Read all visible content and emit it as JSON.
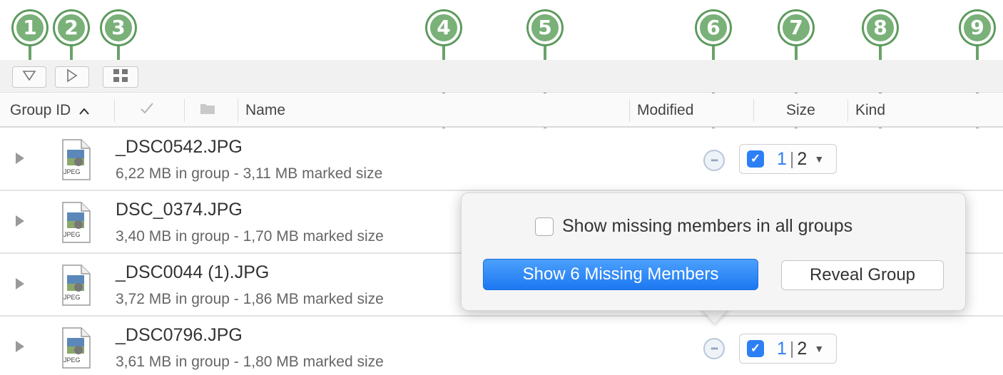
{
  "callouts": [
    "1",
    "2",
    "3",
    "4",
    "5",
    "6",
    "7",
    "8",
    "9"
  ],
  "toolbar": {
    "buttons": [
      {
        "icon": "triangle-down-outline-icon"
      },
      {
        "icon": "triangle-right-outline-icon"
      },
      {
        "icon": "grid-squares-icon"
      }
    ]
  },
  "header": {
    "group_id": "Group ID",
    "sort_indicator": "^",
    "check_icon": "checkmark-icon",
    "folder_icon": "folder-icon",
    "name": "Name",
    "modified": "Modified",
    "size": "Size",
    "kind": "Kind"
  },
  "rows": [
    {
      "name": "_DSC0542.JPG",
      "sub": "6,22 MB in group - 3,11 MB marked size",
      "icon_label": "JPEG",
      "marked": "1",
      "sep": "|",
      "total": "2"
    },
    {
      "name": "DSC_0374.JPG",
      "sub": "3,40 MB in group - 1,70 MB marked size",
      "icon_label": "JPEG"
    },
    {
      "name": "_DSC0044 (1).JPG",
      "sub": "3,72 MB in group - 1,86 MB marked size",
      "icon_label": "JPEG"
    },
    {
      "name": "_DSC0796.JPG",
      "sub": "3,61 MB in group - 1,80 MB marked size",
      "icon_label": "JPEG",
      "marked": "1",
      "sep": "|",
      "total": "2"
    }
  ],
  "popover": {
    "checkbox_label": "Show missing members in all groups",
    "checkbox_checked": false,
    "primary_button": "Show 6 Missing Members",
    "secondary_button": "Reveal Group"
  },
  "colors": {
    "callout_green": "#79b179",
    "accent_blue": "#2d7ff5"
  }
}
